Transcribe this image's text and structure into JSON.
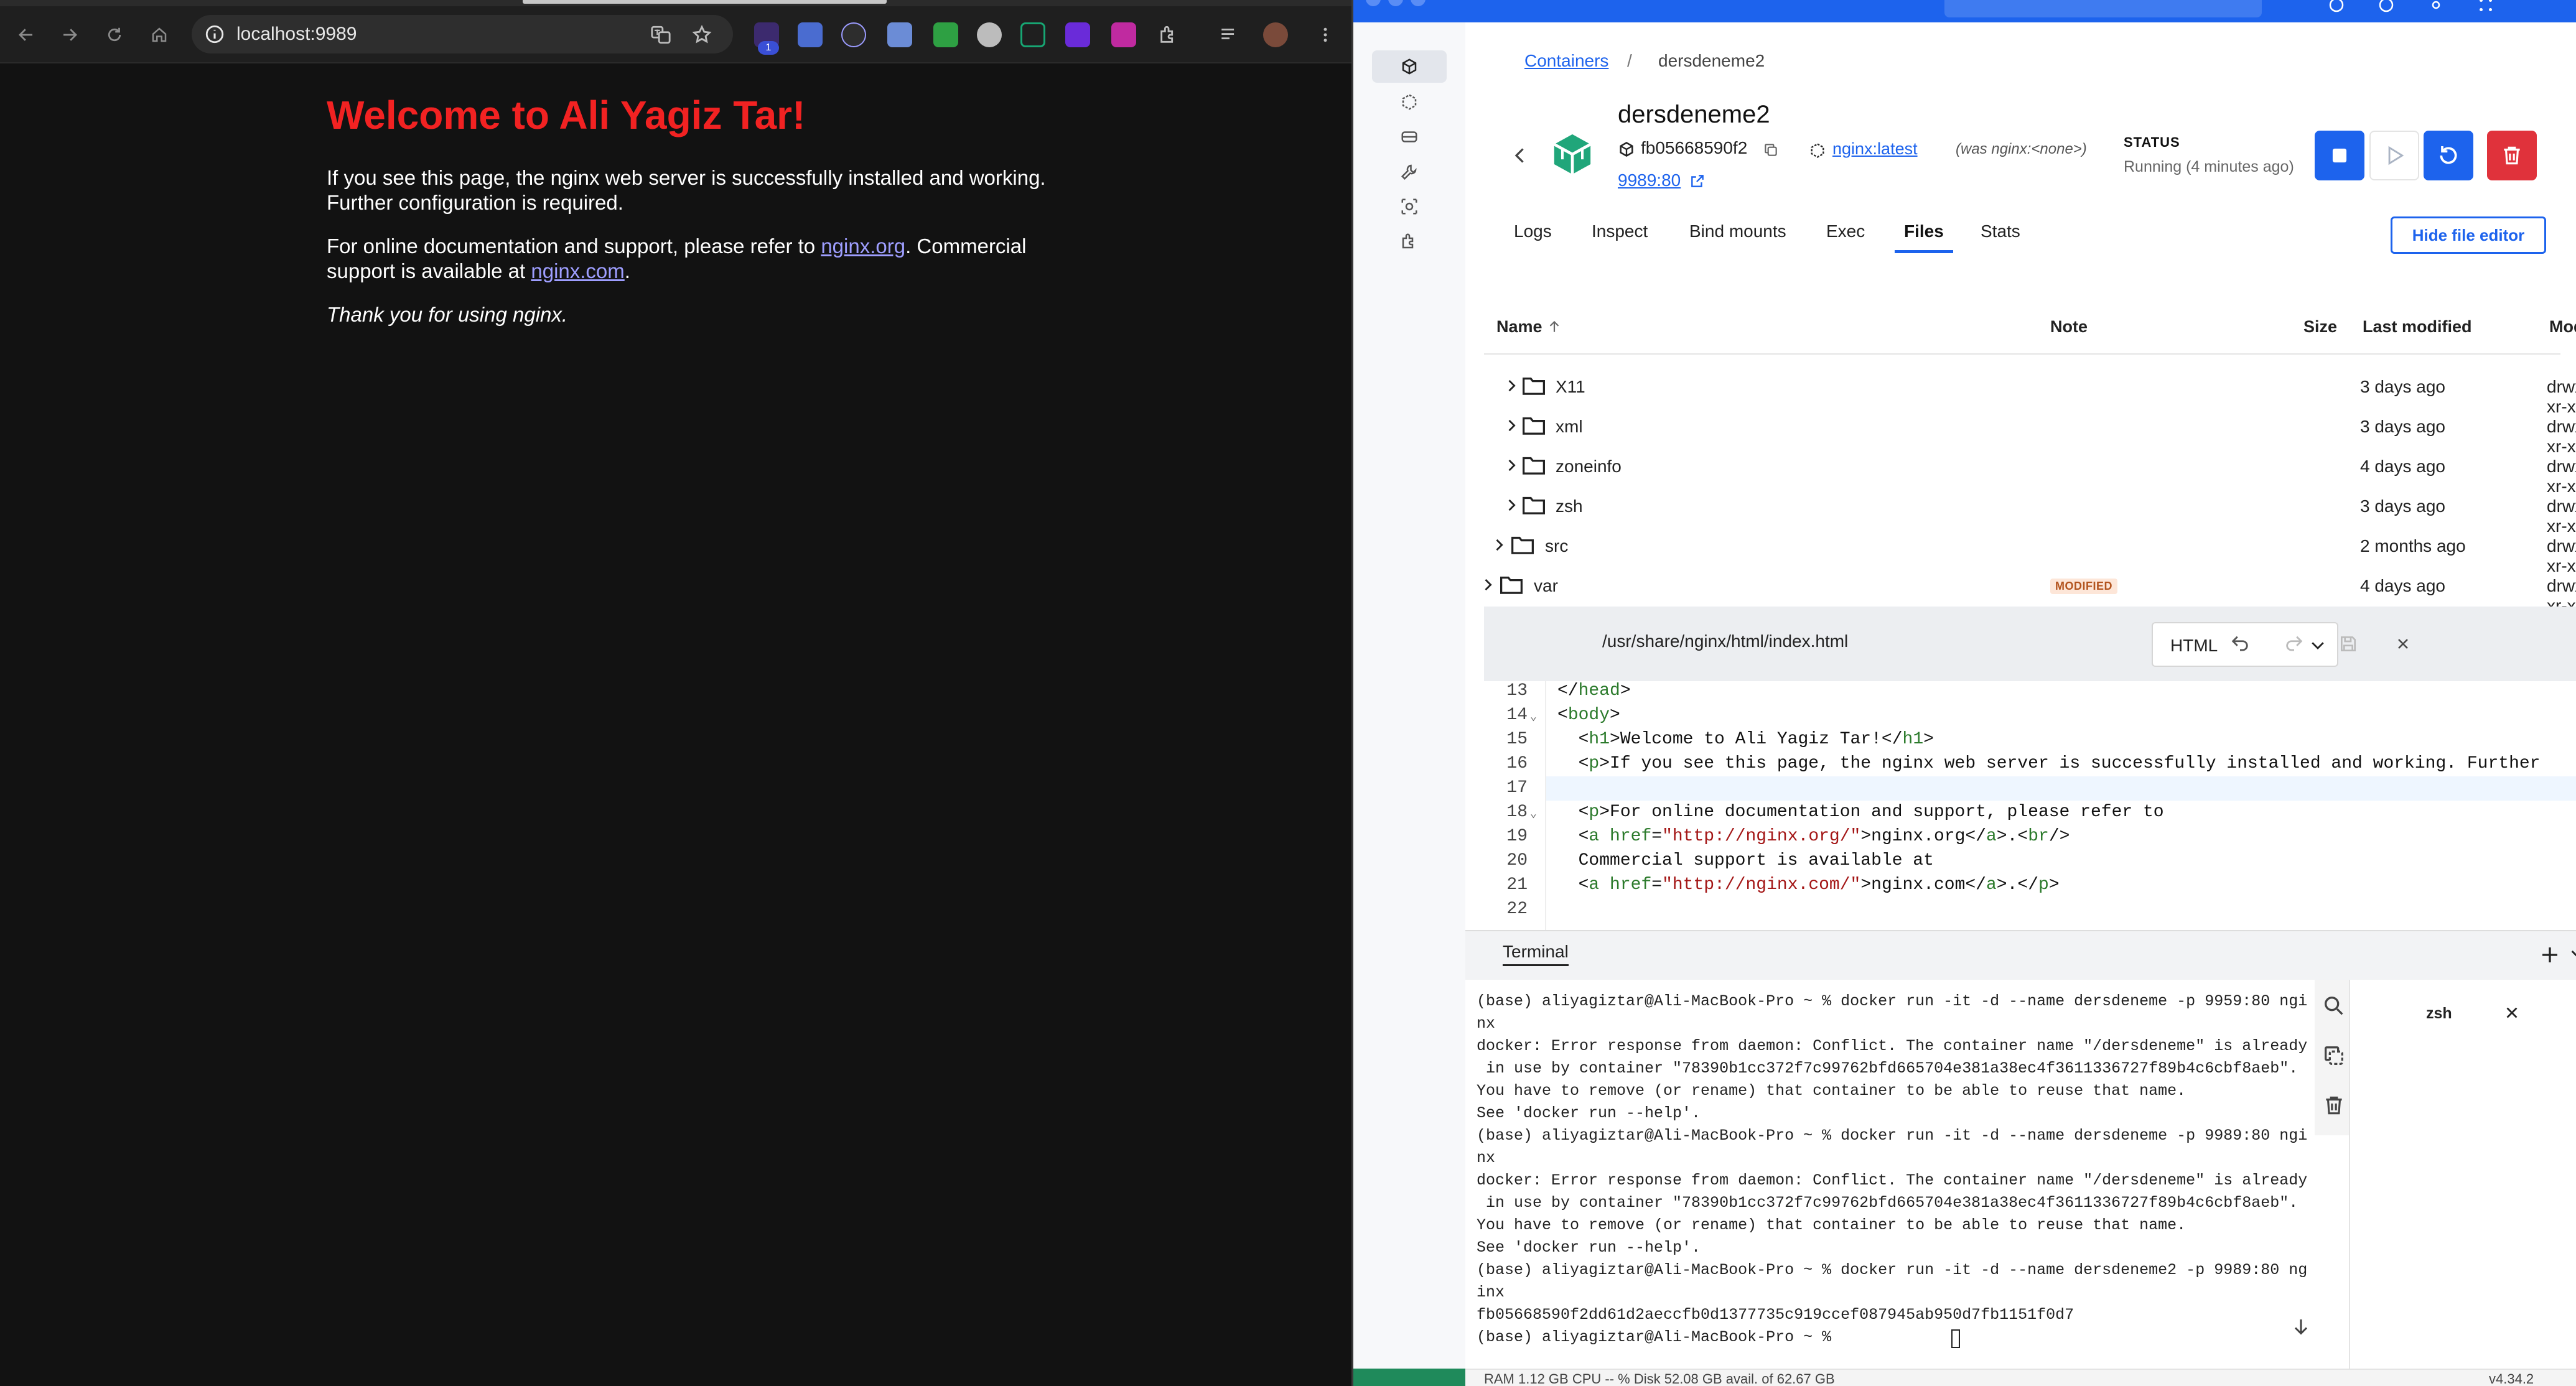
{
  "browser": {
    "url": "localhost:9989",
    "extension_badge": "1"
  },
  "nginx": {
    "heading": "Welcome to Ali Yagiz Tar!",
    "para1": "If you see this page, the nginx web server is successfully installed and working. Further configuration is required.",
    "para2_prefix": "For online documentation and support, please refer to ",
    "para2_link": "nginx.org",
    "para2_mid": ". Commercial support is available at ",
    "para2_link2": "nginx.com",
    "para2_suffix": ".",
    "para3": "Thank you for using nginx."
  },
  "docker": {
    "breadcrumb": {
      "root": "Containers",
      "sep": "/",
      "current": "dersdeneme2"
    },
    "container": {
      "name": "dersdeneme2",
      "id": "fb05668590f2",
      "port": "9989:80",
      "image": "nginx:latest",
      "image_was": "(was nginx:<none>)",
      "status_label": "STATUS",
      "status_value": "Running (4 minutes ago)"
    },
    "tabs": [
      "Logs",
      "Inspect",
      "Bind mounts",
      "Exec",
      "Files",
      "Stats"
    ],
    "active_tab": "Files",
    "hide_editor": "Hide file editor",
    "file_table": {
      "headers": {
        "name": "Name",
        "note": "Note",
        "size": "Size",
        "modified": "Last modified",
        "mode": "Mode"
      },
      "rows": [
        {
          "name": "X11",
          "note": "",
          "modified": "3 days ago",
          "mode": "drwxr-xr-x"
        },
        {
          "name": "xml",
          "note": "",
          "modified": "3 days ago",
          "mode": "drwxr-xr-x"
        },
        {
          "name": "zoneinfo",
          "note": "",
          "modified": "4 days ago",
          "mode": "drwxr-xr-x"
        },
        {
          "name": "zsh",
          "note": "",
          "modified": "3 days ago",
          "mode": "drwxr-xr-x"
        },
        {
          "name": "src",
          "note": "",
          "modified": "2 months ago",
          "mode": "drwxr-xr-x"
        },
        {
          "name": "var",
          "note": "MODIFIED",
          "modified": "4 days ago",
          "mode": "drwxr-xr-x"
        }
      ]
    },
    "editor": {
      "path": "/usr/share/nginx/html/index.html",
      "language": "HTML",
      "line_numbers": [
        "13",
        "14",
        "15",
        "16",
        "17",
        "18",
        "19",
        "20",
        "21",
        "22"
      ]
    },
    "terminal": {
      "title": "Terminal",
      "session": "zsh",
      "lines": [
        "(base) aliyagiztar@Ali-MacBook-Pro ~ % docker run -it -d --name dersdeneme -p 9959:80 ngi",
        "nx",
        "docker: Error response from daemon: Conflict. The container name \"/dersdeneme\" is already",
        " in use by container \"78390b1cc372f7c99762bfd665704e381a38ec4f3611336727f89b4c6cbf8aeb\".",
        "You have to remove (or rename) that container to be able to reuse that name.",
        "See 'docker run --help'.",
        "(base) aliyagiztar@Ali-MacBook-Pro ~ % docker run -it -d --name dersdeneme -p 9989:80 ngi",
        "nx",
        "docker: Error response from daemon: Conflict. The container name \"/dersdeneme\" is already",
        " in use by container \"78390b1cc372f7c99762bfd665704e381a38ec4f3611336727f89b4c6cbf8aeb\".",
        "You have to remove (or rename) that container to be able to reuse that name.",
        "See 'docker run --help'.",
        "(base) aliyagiztar@Ali-MacBook-Pro ~ % docker run -it -d --name dersdeneme2 -p 9989:80 ng",
        "inx",
        "fb05668590f2dd61d2aeccfb0d1377735c919ccef087945ab950d7fb1151f0d7",
        "(base) aliyagiztar@Ali-MacBook-Pro ~ % "
      ]
    },
    "statusbar": {
      "resources": "RAM 1.12 GB  CPU -- %     Disk 52.08 GB avail. of 62.67 GB",
      "version": "v4.34.2"
    }
  },
  "colors": {
    "docker_blue": "#1d63ed",
    "danger_red": "#e0323b",
    "nginx_red": "#f22222",
    "link_purple": "#9e9eff"
  }
}
